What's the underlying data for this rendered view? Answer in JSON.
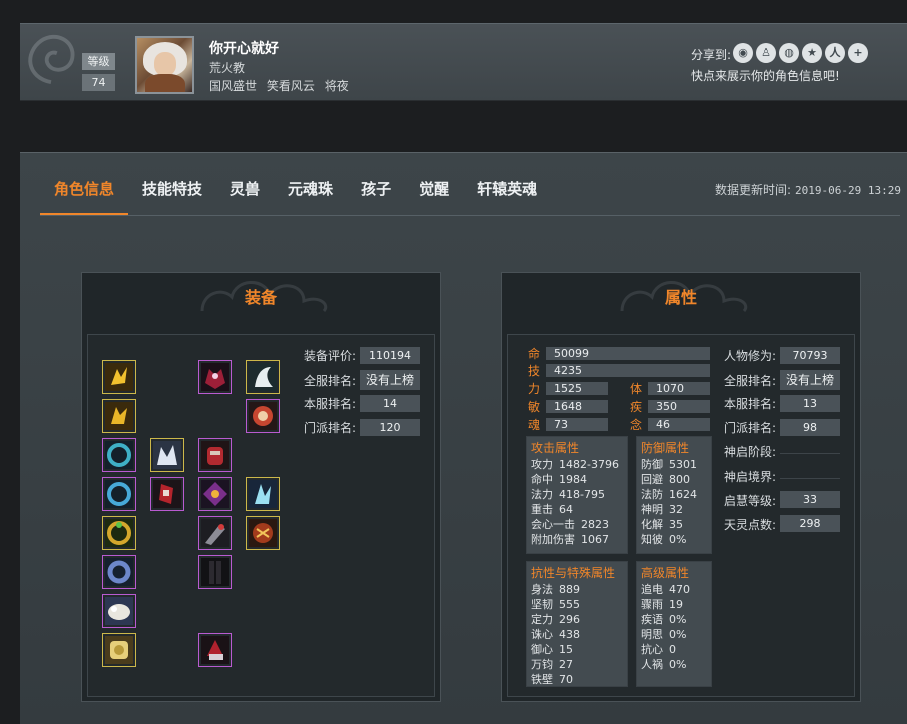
{
  "profile": {
    "level_label": "等级",
    "level_value": "74",
    "name": "你开心就好",
    "sect": "荒火教",
    "tags": [
      "国风盛世",
      "笑看风云",
      "将夜"
    ],
    "share_label": "分享到:",
    "share_icons": [
      "wechat-icon",
      "qq-icon",
      "weibo-icon",
      "qzone-icon",
      "renren-icon",
      "plus-icon"
    ],
    "share_hint": "快点来展示你的角色信息吧!"
  },
  "tabs": [
    "角色信息",
    "技能特技",
    "灵兽",
    "元魂珠",
    "孩子",
    "觉醒",
    "轩辕英魂"
  ],
  "update_label": "数据更新时间:",
  "update_time": "2019-06-29 13:29",
  "equipment": {
    "title": "装备",
    "stats": [
      {
        "label": "装备评价:",
        "value": "110194"
      },
      {
        "label": "全服排名:",
        "value": "没有上榜"
      },
      {
        "label": "本服排名:",
        "value": "14"
      },
      {
        "label": "门派排名:",
        "value": "120"
      }
    ]
  },
  "attributes": {
    "title": "属性",
    "core": {
      "ming_label": "命",
      "ming": "50099",
      "ji_label": "技",
      "ji": "4235",
      "li_label": "力",
      "li": "1525",
      "ti_label": "体",
      "ti": "1070",
      "min_label": "敏",
      "min": "1648",
      "ji2_label": "疾",
      "ji2": "350",
      "hun_label": "魂",
      "hun": "73",
      "nian_label": "念",
      "nian": "46"
    },
    "right": [
      {
        "label": "人物修为:",
        "value": "70793"
      },
      {
        "label": "全服排名:",
        "value": "没有上榜"
      },
      {
        "label": "本服排名:",
        "value": "13"
      },
      {
        "label": "门派排名:",
        "value": "98"
      },
      {
        "label": "神启阶段:",
        "value": ""
      },
      {
        "label": "神启境界:",
        "value": ""
      },
      {
        "label": "启慧等级:",
        "value": "33"
      },
      {
        "label": "天灵点数:",
        "value": "298"
      }
    ],
    "attack": {
      "title": "攻击属性",
      "rows": [
        {
          "k": "攻力",
          "v": "1482-3796"
        },
        {
          "k": "命中",
          "v": "1984"
        },
        {
          "k": "法力",
          "v": "418-795"
        },
        {
          "k": "重击",
          "v": "64"
        },
        {
          "k": "会心一击",
          "v": "2823"
        },
        {
          "k": "附加伤害",
          "v": "1067"
        }
      ]
    },
    "defense": {
      "title": "防御属性",
      "rows": [
        {
          "k": "防御",
          "v": "5301"
        },
        {
          "k": "回避",
          "v": "800"
        },
        {
          "k": "法防",
          "v": "1624"
        },
        {
          "k": "神明",
          "v": "32"
        },
        {
          "k": "化解",
          "v": "35"
        },
        {
          "k": "知彼",
          "v": "0%"
        }
      ]
    },
    "resist": {
      "title": "抗性与特殊属性",
      "rows": [
        {
          "k": "身法",
          "v": "889"
        },
        {
          "k": "坚韧",
          "v": "555"
        },
        {
          "k": "定力",
          "v": "296"
        },
        {
          "k": "诛心",
          "v": "438"
        },
        {
          "k": "御心",
          "v": "15"
        },
        {
          "k": "万钧",
          "v": "27"
        },
        {
          "k": "铁壁",
          "v": "70"
        }
      ]
    },
    "advanced": {
      "title": "高级属性",
      "rows": [
        {
          "k": "追电",
          "v": "470"
        },
        {
          "k": "骤雨",
          "v": "19"
        },
        {
          "k": "疾语",
          "v": "0%"
        },
        {
          "k": "明思",
          "v": "0%"
        },
        {
          "k": "抗心",
          "v": "0"
        },
        {
          "k": "人祸",
          "v": "0%"
        }
      ]
    }
  },
  "colors": {
    "accent": "#f0862a",
    "gold_border": "#ccb84a",
    "purple_border": "#b95bd1"
  }
}
